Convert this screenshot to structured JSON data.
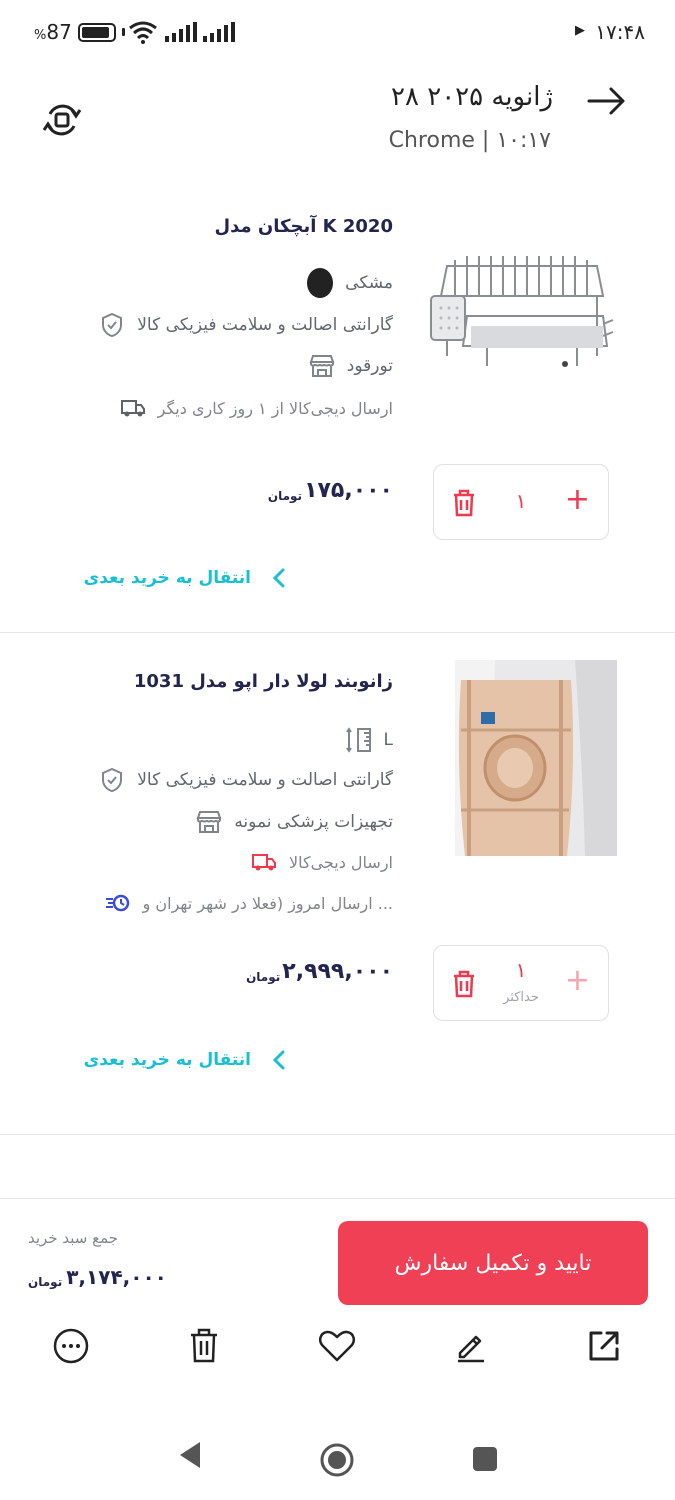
{
  "status_bar": {
    "time": "۱۷:۴۸",
    "battery": "87",
    "battery_suffix": "%"
  },
  "header": {
    "title": "۲۸ ژانویه ۲۰۲۵",
    "subtitle": "Chrome | ۱۰:۱۷"
  },
  "items": [
    {
      "name": "آبچکان مدل K 2020",
      "color_name": "مشکی",
      "color_hex": "#222222",
      "warranty": "گارانتی اصالت و سلامت فیزیکی کالا",
      "seller": "تورقود",
      "shipping": "ارسال دیجی‌کالا از ۱ روز کاری دیگر",
      "price": "۱۷۵,۰۰۰",
      "currency": "تومان",
      "quantity": "۱",
      "move_label": "انتقال به خرید بعدی"
    },
    {
      "name": "زانوبند لولا دار اپو مدل 1031",
      "size": "L",
      "warranty": "گارانتی اصالت و سلامت فیزیکی کالا",
      "seller": "تجهیزات پزشکی نمونه",
      "shipping": "ارسال دیجی‌کالا",
      "fast_shipping": "ارسال امروز (فعلا در شهر تهران و ...",
      "price": "۲,۹۹۹,۰۰۰",
      "currency": "تومان",
      "quantity": "۱",
      "max_label": "حداکثر",
      "move_label": "انتقال به خرید بعدی"
    }
  ],
  "footer": {
    "checkout_label": "تایید و تکمیل سفارش",
    "total_label": "جمع سبد خرید",
    "total_value": "۳,۱۷۴,۰۰۰",
    "currency": "تومان"
  },
  "actions": [
    "open-external-icon",
    "edit-icon",
    "heart-icon",
    "trash-icon",
    "more-icon"
  ],
  "colors": {
    "accent": "#ef394e",
    "link": "#19bfd3",
    "text_primary": "#23254e"
  }
}
